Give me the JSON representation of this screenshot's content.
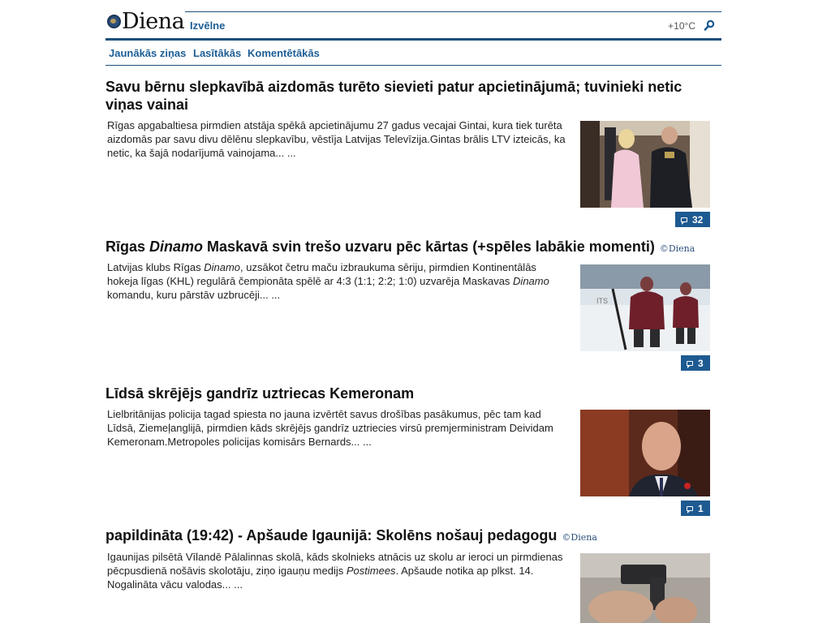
{
  "header": {
    "logo_text": "Diena",
    "menu_label": "Izvēlne",
    "temperature": "+10°C"
  },
  "subnav": {
    "items": [
      "Jaunākās ziņas",
      "Lasītākās",
      "Komentētākās"
    ]
  },
  "articles": [
    {
      "title": "Savu bērnu slepkavībā aizdomās turēto sievieti patur apcietinājumā; tuvinieki netic viņas vainai",
      "lead": "Rīgas apgabaltiesa pirmdien atstāja spēkā apcietinājumu 27 gadus vecajai Gintai, kura tiek turēta aizdomās par savu divu dēlēnu slepkavību, vēstīja Latvijas Televīzija.Gintas brālis LTV izteicās, ka netic, ka šajā nodarījumā vainojama... ...",
      "comments": "32",
      "image": "woman-escorted-by-police-photo"
    },
    {
      "title_parts": [
        "Rīgas ",
        "Dinamo",
        " Maskavā svin trešo uzvaru pēc kārtas (+spēles labākie momenti)"
      ],
      "stamp": "©Diena",
      "lead_parts": [
        "Latvijas klubs Rīgas ",
        "Dinamo",
        ", uzsākot četru maču izbraukuma sēriju, pirmdien Kontinentālās hokeja līgas (KHL) regulārā čempionāta spēlē ar 4:3 (1:1; 2:2; 1:0) uzvarēja Maskavas ",
        "Dinamo",
        " komandu, kuru pārstāv uzbrucēji... ..."
      ],
      "comments": "3",
      "image": "hockey-players-photo"
    },
    {
      "title": "Līdsā skrējējs gandrīz uztriecas Kemeronam",
      "lead": "Lielbritānijas policija tagad spiesta no jauna izvērtēt savus drošības pasākumus, pēc tam kad Līdsā, Ziemeļanglijā, pirmdien kāds skrējējs gandrīz uztriecies virsū premjerministram Deividam Kemeronam.Metropoles policijas komisārs Bernards... ...",
      "comments": "1",
      "image": "david-cameron-photo"
    },
    {
      "title": "papildināta (19:42) - Apšaude Igaunijā: Skolēns nošauj pedagogu",
      "stamp": "©Diena",
      "lead_parts": [
        "Igaunijas pilsētā Vīlandē Pālalinnas skolā, kāds skolnieks atnācis uz skolu ar ieroci un pirmdienas pēcpusdienā nošāvis skolotāju, ziņo igauņu medijs ",
        "Postimees",
        ".  Apšaude notika ap plkst. 14. Nogalināta vācu valodas... ..."
      ],
      "image": "handgun-photo"
    }
  ],
  "colors": {
    "brand_blue": "#1d5a91",
    "rule_blue": "#1d4f7b"
  }
}
